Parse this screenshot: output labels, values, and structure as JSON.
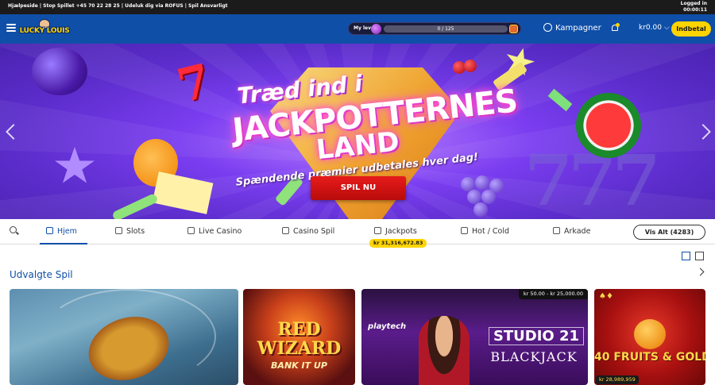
{
  "topbar": {
    "links": "Hjælpeside | Stop Spillet +45 70 22 28 25 | Udeluk dig via ROFUS | Spil Ansvarligt",
    "status_line1": "Logged in",
    "status_line2": "00:00:11"
  },
  "header": {
    "logo_text": "LUCKY LOUIS",
    "level": {
      "label": "My level",
      "progress_text": "0 / 125",
      "progress_value": 0,
      "progress_max": 125
    },
    "kampagner_label": "Kampagner",
    "balance": "kr0.00",
    "deposit_label": "Indbetal"
  },
  "hero": {
    "title_line1": "Træd ind i",
    "title_line2": "JACKPOTTERNES",
    "title_line3": "LAND",
    "subtitle": "Spændende præmier udbetales hver dag!",
    "cta_label": "SPIL NU"
  },
  "nav": {
    "tabs": [
      {
        "label": "Hjem",
        "icon": "home-icon",
        "active": true
      },
      {
        "label": "Slots",
        "icon": "slots-icon",
        "active": false
      },
      {
        "label": "Live Casino",
        "icon": "live-dealer-icon",
        "active": false
      },
      {
        "label": "Casino Spil",
        "icon": "casino-games-icon",
        "active": false
      },
      {
        "label": "Jackpots",
        "icon": "jackpot-icon",
        "active": false
      },
      {
        "label": "Hot / Cold",
        "icon": "hot-cold-icon",
        "active": false
      },
      {
        "label": "Arkade",
        "icon": "arcade-icon",
        "active": false
      }
    ],
    "jackpot_amount": "kr 31,316,672.83",
    "vis_alt_label": "Vis Alt (4283)"
  },
  "section": {
    "title": "Udvalgte Spil"
  },
  "games": [
    {
      "name": "Fishing slot"
    },
    {
      "name_line1": "RED",
      "name_line2": "WIZARD",
      "name_line3": "BANK IT UP"
    },
    {
      "bet_range": "kr 50.00 - kr 25,000.00",
      "provider": "playtech",
      "title_line1": "STUDIO 21",
      "title_line2": "BLACKJACK"
    },
    {
      "name": "40 FRUITS & GOLD",
      "jackpot": "kr 28,989,959"
    }
  ],
  "colors": {
    "brand_blue": "#0f4fa8",
    "accent_yellow": "#ffd400",
    "cta_red": "#e81b1b"
  }
}
